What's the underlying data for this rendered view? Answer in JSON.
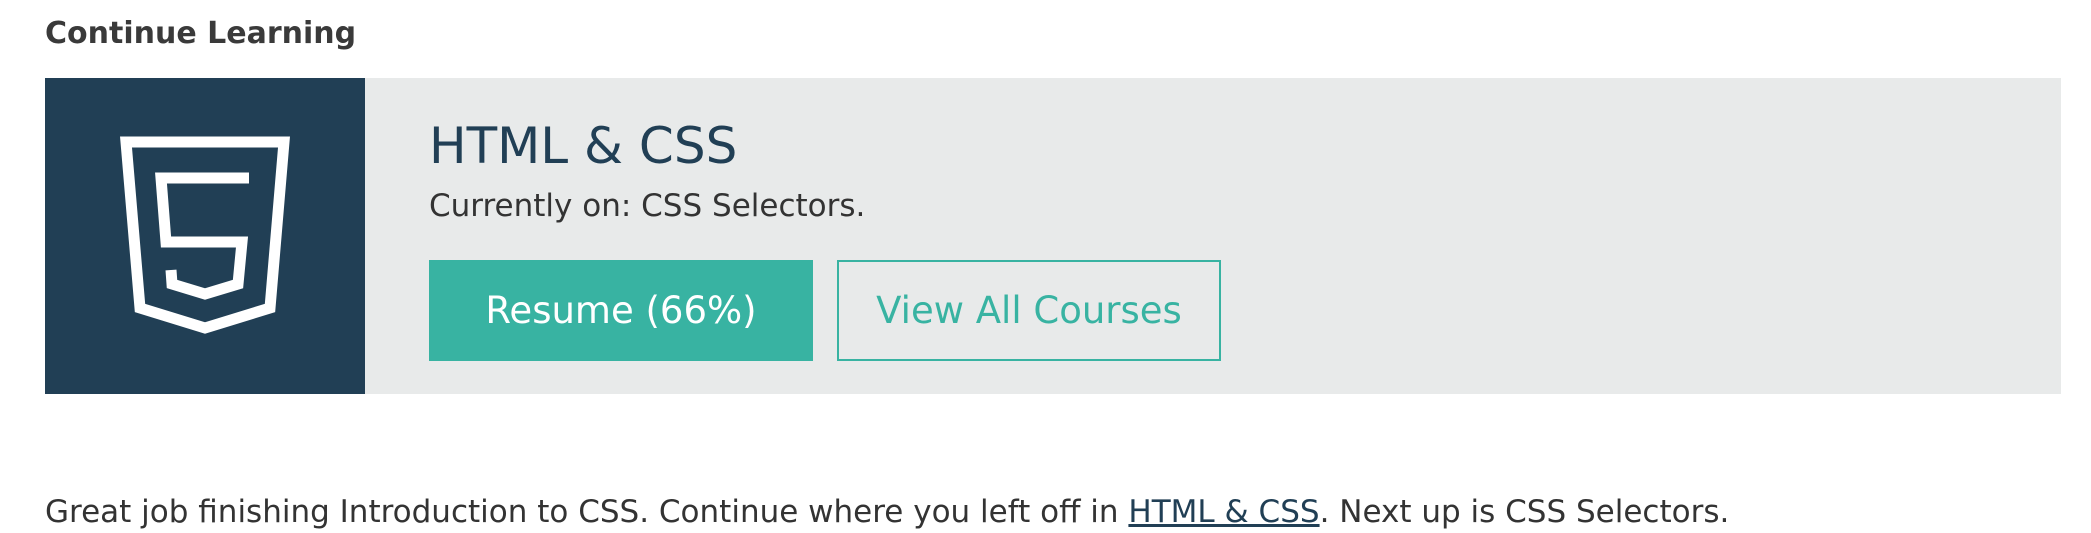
{
  "section": {
    "heading": "Continue Learning"
  },
  "course": {
    "logo_icon": "html5-shield-icon",
    "title": "HTML & CSS",
    "current_prefix": "Currently on: ",
    "current_lesson": "CSS Selectors.",
    "resume_label": "Resume (66%)",
    "progress_percent": 66,
    "view_all_label": "View All Courses"
  },
  "message": {
    "before_link": "Great job finishing Introduction to CSS. Continue where you left off in ",
    "link_text": "HTML & CSS",
    "after_link": ". Next up is CSS Selectors."
  },
  "colors": {
    "logo_background": "#213f55",
    "card_background": "#e8eaea",
    "accent": "#38b3a2",
    "title_text": "#213f55"
  }
}
